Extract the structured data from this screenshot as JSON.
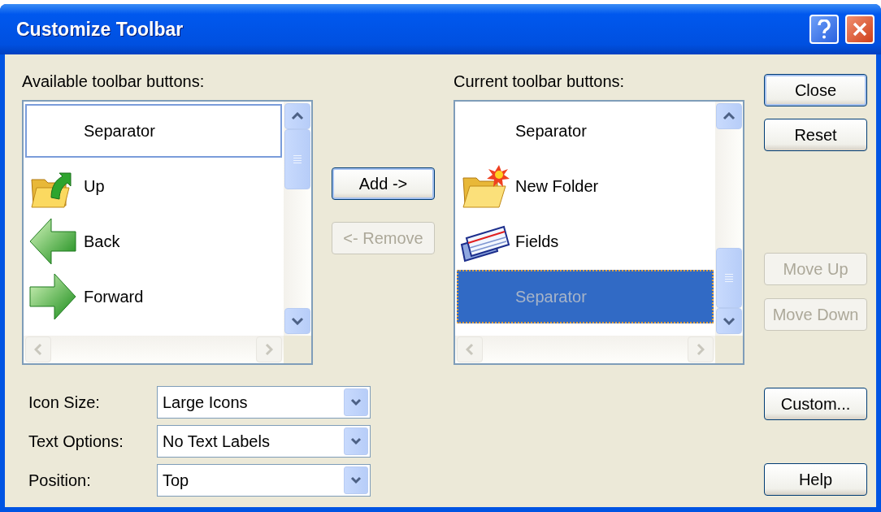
{
  "window": {
    "title": "Customize Toolbar"
  },
  "available": {
    "label": "Available toolbar buttons:",
    "items": [
      {
        "label": "Separator",
        "kind": "separator",
        "selected": false,
        "focused": true
      },
      {
        "label": "Up",
        "kind": "up",
        "selected": false,
        "focused": false
      },
      {
        "label": "Back",
        "kind": "back",
        "selected": false,
        "focused": false
      },
      {
        "label": "Forward",
        "kind": "forward",
        "selected": false,
        "focused": false
      }
    ]
  },
  "transfer_buttons": [
    {
      "label": "Add ->",
      "disabled": false,
      "default": true
    },
    {
      "label": "<- Remove",
      "disabled": true,
      "default": false
    }
  ],
  "current": {
    "label": "Current toolbar buttons:",
    "items": [
      {
        "label": "Separator",
        "kind": "separator",
        "selected": false,
        "focused": false
      },
      {
        "label": "New Folder",
        "kind": "new-folder",
        "selected": false,
        "focused": false
      },
      {
        "label": "Fields",
        "kind": "fields",
        "selected": false,
        "focused": false
      },
      {
        "label": "Separator",
        "kind": "separator",
        "selected": true,
        "focused": true
      }
    ]
  },
  "side_buttons": [
    {
      "label": "Close",
      "disabled": false,
      "default": true
    },
    {
      "label": "Reset",
      "disabled": false,
      "default": false
    },
    {
      "label": "Move Up",
      "disabled": true,
      "default": false
    },
    {
      "label": "Move Down",
      "disabled": true,
      "default": false
    },
    {
      "label": "Custom...",
      "disabled": false,
      "default": false
    },
    {
      "label": "Help",
      "disabled": false,
      "default": false
    }
  ],
  "options": [
    {
      "label": "Icon Size:",
      "value": "Large Icons"
    },
    {
      "label": "Text Options:",
      "value": "No Text Labels"
    },
    {
      "label": "Position:",
      "value": "Top"
    }
  ]
}
